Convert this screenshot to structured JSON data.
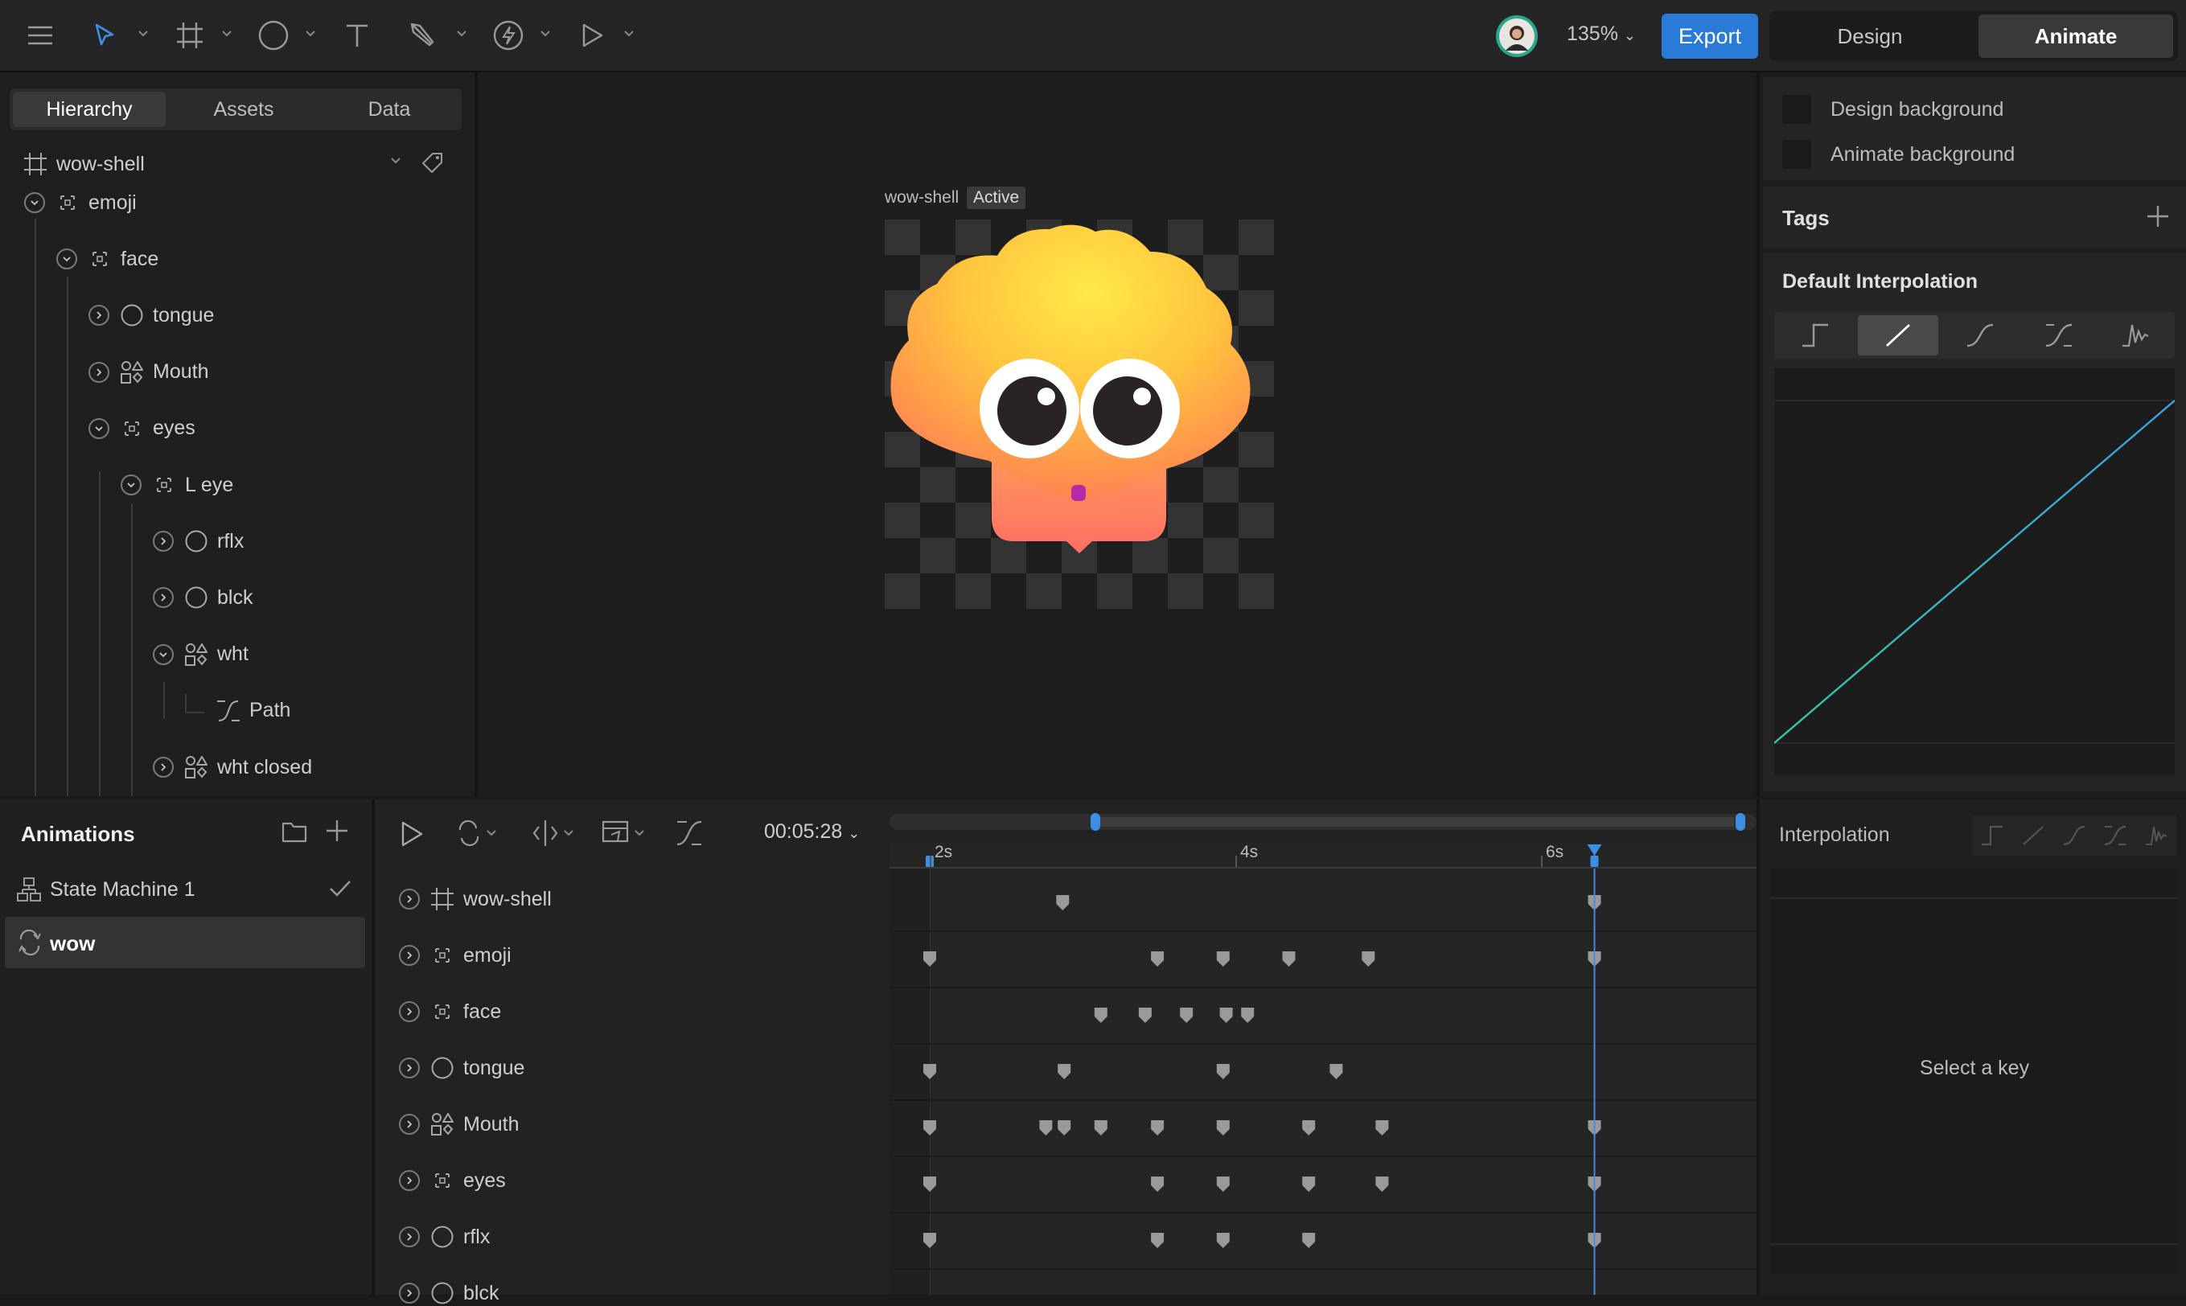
{
  "topbar": {
    "zoom": "135%",
    "export_label": "Export",
    "modes": [
      "Design",
      "Animate"
    ],
    "active_mode": "Animate"
  },
  "hierarchy": {
    "tabs": [
      "Hierarchy",
      "Assets",
      "Data"
    ],
    "active_tab": "Hierarchy",
    "artboard": "wow-shell",
    "tree": [
      {
        "label": "emoji",
        "icon": "group-icon",
        "depth": 0,
        "expanded": true
      },
      {
        "label": "face",
        "icon": "group-icon",
        "depth": 1,
        "expanded": true
      },
      {
        "label": "tongue",
        "icon": "ellipse-icon",
        "depth": 2,
        "expanded": false
      },
      {
        "label": "Mouth",
        "icon": "shapes-icon",
        "depth": 2,
        "expanded": false
      },
      {
        "label": "eyes",
        "icon": "group-icon",
        "depth": 2,
        "expanded": true
      },
      {
        "label": "L eye",
        "icon": "group-icon",
        "depth": 3,
        "expanded": true
      },
      {
        "label": "rflx",
        "icon": "ellipse-icon",
        "depth": 4,
        "expanded": false
      },
      {
        "label": "blck",
        "icon": "ellipse-icon",
        "depth": 4,
        "expanded": false
      },
      {
        "label": "wht",
        "icon": "shapes-icon",
        "depth": 4,
        "expanded": true
      },
      {
        "label": "Path",
        "icon": "path-icon",
        "depth": 5,
        "expanded": null
      },
      {
        "label": "wht closed",
        "icon": "shapes-icon",
        "depth": 4,
        "expanded": false
      }
    ]
  },
  "canvas": {
    "artboard_name": "wow-shell",
    "state_badge": "Active"
  },
  "inspector": {
    "design_background": "Design background",
    "animate_background": "Animate background",
    "tags_title": "Tags",
    "default_interpolation_title": "Default Interpolation",
    "interpolation_modes": [
      "hold",
      "linear",
      "cubic",
      "custom",
      "elastic"
    ],
    "active_interpolation": "linear"
  },
  "animations": {
    "title": "Animations",
    "items": [
      {
        "label": "State Machine 1",
        "icon": "state-machine-icon",
        "selected": false
      },
      {
        "label": "wow",
        "icon": "loop-icon",
        "selected": true
      }
    ]
  },
  "timeline": {
    "time": "00:05:28",
    "rulers": [
      "2s",
      "4s",
      "6s"
    ],
    "rows": [
      {
        "label": "wow-shell",
        "icon": "artboard-icon",
        "keys": [
          2.87,
          6.35
        ]
      },
      {
        "label": "emoji",
        "icon": "group-icon",
        "keys": [
          2.0,
          3.49,
          3.92,
          4.35,
          4.87,
          6.35
        ]
      },
      {
        "label": "face",
        "icon": "group-icon",
        "keys": [
          3.12,
          3.41,
          3.68,
          3.94,
          4.08
        ]
      },
      {
        "label": "tongue",
        "icon": "ellipse-icon",
        "keys": [
          2.0,
          2.88,
          3.92,
          4.66
        ]
      },
      {
        "label": "Mouth",
        "icon": "shapes-icon",
        "keys": [
          2.0,
          2.76,
          2.88,
          3.12,
          3.49,
          3.92,
          4.48,
          4.96,
          6.35
        ]
      },
      {
        "label": "eyes",
        "icon": "group-icon",
        "keys": [
          2.0,
          3.49,
          3.92,
          4.48,
          4.96,
          6.35
        ]
      },
      {
        "label": "rflx",
        "icon": "ellipse-icon",
        "keys": [
          2.0,
          3.49,
          3.92,
          4.48,
          6.35
        ]
      },
      {
        "label": "blck",
        "icon": "ellipse-icon",
        "keys": []
      }
    ],
    "playhead_s": 6.35
  },
  "interpolation_panel": {
    "title": "Interpolation",
    "empty_text": "Select a key"
  }
}
